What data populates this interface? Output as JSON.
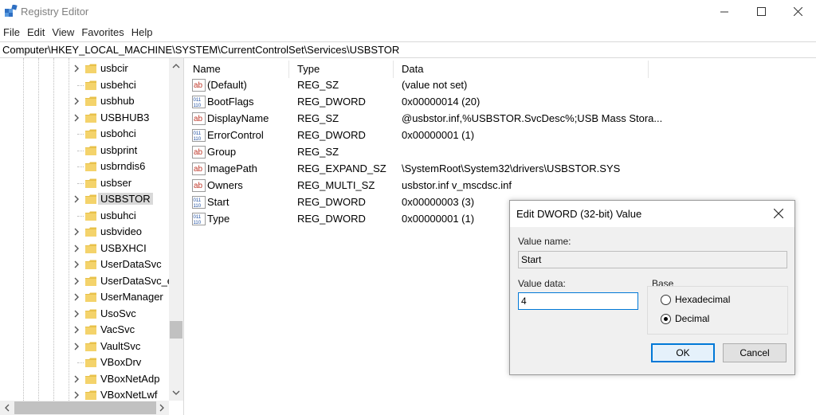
{
  "window": {
    "title": "Registry Editor",
    "app_icon": "registry-icon",
    "minimize_icon": "minimize-icon",
    "maximize_icon": "maximize-icon",
    "close_icon": "close-icon"
  },
  "menu": [
    "File",
    "Edit",
    "View",
    "Favorites",
    "Help"
  ],
  "address": "Computer\\HKEY_LOCAL_MACHINE\\SYSTEM\\CurrentControlSet\\Services\\USBSTOR",
  "tree": {
    "items": [
      {
        "label": "usbcir",
        "expandable": true
      },
      {
        "label": "usbehci",
        "expandable": false
      },
      {
        "label": "usbhub",
        "expandable": true
      },
      {
        "label": "USBHUB3",
        "expandable": true
      },
      {
        "label": "usbohci",
        "expandable": false
      },
      {
        "label": "usbprint",
        "expandable": false
      },
      {
        "label": "usbrndis6",
        "expandable": false
      },
      {
        "label": "usbser",
        "expandable": false
      },
      {
        "label": "USBSTOR",
        "expandable": true,
        "selected": true
      },
      {
        "label": "usbuhci",
        "expandable": false
      },
      {
        "label": "usbvideo",
        "expandable": true
      },
      {
        "label": "USBXHCI",
        "expandable": true
      },
      {
        "label": "UserDataSvc",
        "expandable": true
      },
      {
        "label": "UserDataSvc_e",
        "expandable": true
      },
      {
        "label": "UserManager",
        "expandable": true
      },
      {
        "label": "UsoSvc",
        "expandable": true
      },
      {
        "label": "VacSvc",
        "expandable": true
      },
      {
        "label": "VaultSvc",
        "expandable": true
      },
      {
        "label": "VBoxDrv",
        "expandable": false
      },
      {
        "label": "VBoxNetAdp",
        "expandable": true
      },
      {
        "label": "VBoxNetLwf",
        "expandable": true
      }
    ]
  },
  "values": {
    "columns": {
      "name": "Name",
      "type": "Type",
      "data": "Data"
    },
    "rows": [
      {
        "name": "(Default)",
        "type": "REG_SZ",
        "data": "(value not set)",
        "icon": "string-value-icon"
      },
      {
        "name": "BootFlags",
        "type": "REG_DWORD",
        "data": "0x00000014 (20)",
        "icon": "binary-value-icon"
      },
      {
        "name": "DisplayName",
        "type": "REG_SZ",
        "data": "@usbstor.inf,%USBSTOR.SvcDesc%;USB Mass Stora...",
        "icon": "string-value-icon"
      },
      {
        "name": "ErrorControl",
        "type": "REG_DWORD",
        "data": "0x00000001 (1)",
        "icon": "binary-value-icon"
      },
      {
        "name": "Group",
        "type": "REG_SZ",
        "data": "",
        "icon": "string-value-icon"
      },
      {
        "name": "ImagePath",
        "type": "REG_EXPAND_SZ",
        "data": "\\SystemRoot\\System32\\drivers\\USBSTOR.SYS",
        "icon": "string-value-icon"
      },
      {
        "name": "Owners",
        "type": "REG_MULTI_SZ",
        "data": "usbstor.inf v_mscdsc.inf",
        "icon": "string-value-icon"
      },
      {
        "name": "Start",
        "type": "REG_DWORD",
        "data": "0x00000003 (3)",
        "icon": "binary-value-icon"
      },
      {
        "name": "Type",
        "type": "REG_DWORD",
        "data": "0x00000001 (1)",
        "icon": "binary-value-icon"
      }
    ]
  },
  "dialog": {
    "title": "Edit DWORD (32-bit) Value",
    "value_name_label": "Value name:",
    "value_name": "Start",
    "value_data_label": "Value data:",
    "value_data": "4",
    "base_label": "Base",
    "hex_label": "Hexadecimal",
    "dec_label": "Decimal",
    "base_selected": "Decimal",
    "ok_label": "OK",
    "cancel_label": "Cancel"
  },
  "colors": {
    "folder": "#e8c14a",
    "accent": "#0078d7",
    "selection": "#d9d9d9",
    "chevron": "#555555"
  }
}
